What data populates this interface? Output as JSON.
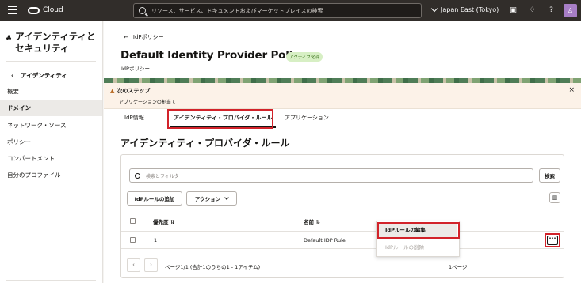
{
  "topbar": {
    "logo_text": "Cloud",
    "search_placeholder": "リソース、サービス、ドキュメントおよびマーケットプレイスの検索",
    "region": "Japan East (Tokyo)"
  },
  "sidebar": {
    "title": "アイデンティティとセキュリティ",
    "back_label": "アイデンティティ",
    "items": [
      {
        "label": "概要"
      },
      {
        "label": "ドメイン"
      },
      {
        "label": "ネットワーク・ソース"
      },
      {
        "label": "ポリシー"
      },
      {
        "label": "コンパートメント"
      },
      {
        "label": "自分のプロファイル"
      }
    ]
  },
  "header": {
    "back_link": "IdPポリシー",
    "title": "Default Identity Provider Policy",
    "status_badge": "アクティブ化済",
    "subtitle": "IdPポリシー"
  },
  "notice": {
    "title": "次のステップ",
    "body": "アプリケーションの割当て"
  },
  "tabs": [
    {
      "label": "IdP情報"
    },
    {
      "label": "アイデンティティ・プロバイダ・ルール"
    },
    {
      "label": "アプリケーション"
    }
  ],
  "section": {
    "title": "アイデンティティ・プロバイダ・ルール",
    "filter_placeholder": "検索とフィルタ",
    "search_button": "検索",
    "add_rule_button": "IdPルールの追加",
    "actions_button": "アクション"
  },
  "table": {
    "columns": {
      "priority": "優先度",
      "name": "名前"
    },
    "rows": [
      {
        "priority": "1",
        "name": "Default IDP Rule"
      }
    ]
  },
  "pager": {
    "text": "ページ1/1 (合計1のうちの1 - 1アイテム)",
    "right_text": "1ページ"
  },
  "context_menu": {
    "edit": "IdPルールの編集",
    "delete": "IdPルールの削除"
  },
  "colors": {
    "highlight": "#d2232a",
    "topbar": "#312d2a",
    "badge_bg": "#d7efc4"
  }
}
